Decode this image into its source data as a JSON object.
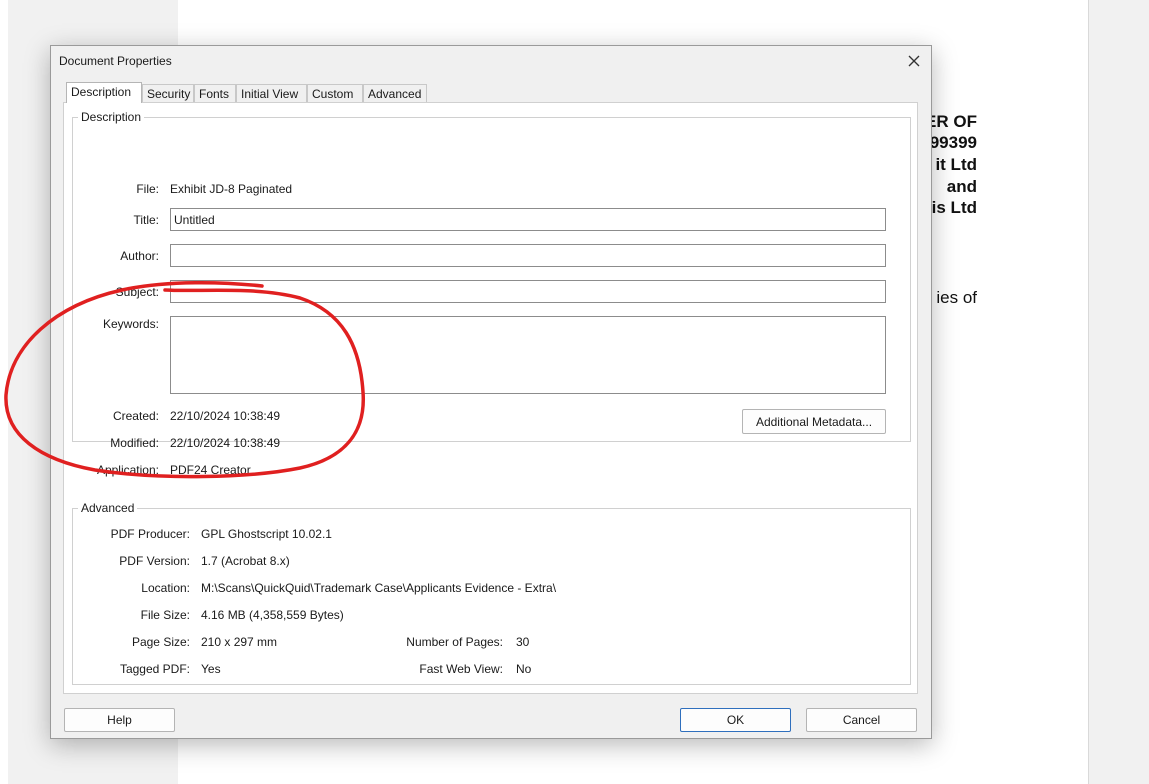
{
  "background_document": {
    "lines": [
      {
        "text": "ER OF",
        "bold": true
      },
      {
        "text": "99399",
        "bold": true
      },
      {
        "text": "it Ltd",
        "bold": true
      },
      {
        "text": "and",
        "bold": true
      },
      {
        "text": "is Ltd",
        "bold": true
      },
      {
        "text": "ies of",
        "bold": false
      }
    ]
  },
  "dialog": {
    "title": "Document Properties",
    "close_icon": "close-icon",
    "tabs": [
      {
        "label": "Description",
        "active": true
      },
      {
        "label": "Security",
        "active": false
      },
      {
        "label": "Fonts",
        "active": false
      },
      {
        "label": "Initial View",
        "active": false
      },
      {
        "label": "Custom",
        "active": false
      },
      {
        "label": "Advanced",
        "active": false
      }
    ],
    "description": {
      "group_label": "Description",
      "file_label": "File:",
      "file_value": "Exhibit JD-8 Paginated",
      "title_label": "Title:",
      "title_value": "Untitled",
      "author_label": "Author:",
      "author_value": "",
      "subject_label": "Subject:",
      "subject_value": "",
      "keywords_label": "Keywords:",
      "keywords_value": "",
      "created_label": "Created:",
      "created_value": "22/10/2024 10:38:49",
      "modified_label": "Modified:",
      "modified_value": "22/10/2024 10:38:49",
      "application_label": "Application:",
      "application_value": "PDF24 Creator",
      "additional_metadata_button": "Additional Metadata..."
    },
    "advanced": {
      "group_label": "Advanced",
      "pdf_producer_label": "PDF Producer:",
      "pdf_producer_value": "GPL Ghostscript 10.02.1",
      "pdf_version_label": "PDF Version:",
      "pdf_version_value": "1.7 (Acrobat 8.x)",
      "location_label": "Location:",
      "location_value": "M:\\Scans\\QuickQuid\\Trademark Case\\Applicants Evidence - Extra\\",
      "file_size_label": "File Size:",
      "file_size_value": "4.16 MB (4,358,559 Bytes)",
      "page_size_label": "Page Size:",
      "page_size_value": "210 x 297 mm",
      "num_pages_label": "Number of Pages:",
      "num_pages_value": "30",
      "tagged_pdf_label": "Tagged PDF:",
      "tagged_pdf_value": "Yes",
      "fast_web_view_label": "Fast Web View:",
      "fast_web_view_value": "No"
    },
    "buttons": {
      "help": "Help",
      "ok": "OK",
      "cancel": "Cancel"
    }
  },
  "annotation": {
    "type": "hand-drawn-circle",
    "color": "#e02020"
  }
}
